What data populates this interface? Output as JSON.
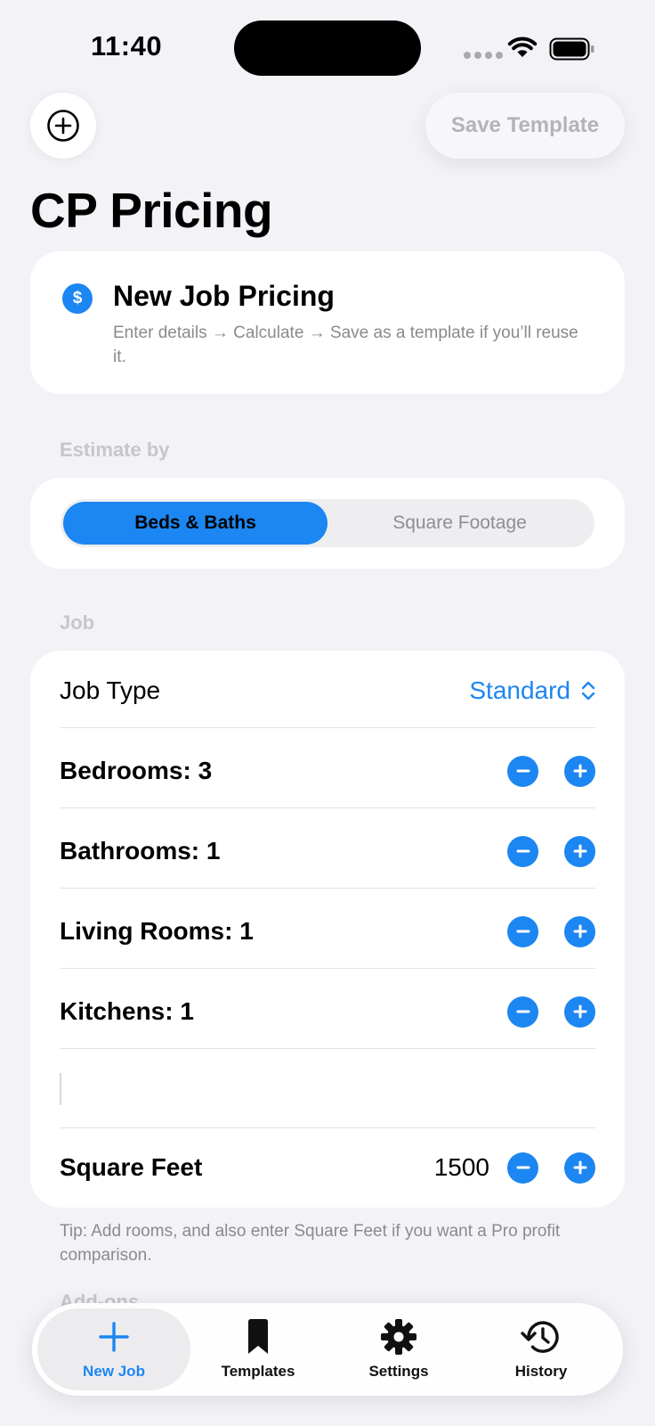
{
  "status": {
    "time": "11:40"
  },
  "top": {
    "add_label": "+",
    "save_template_label": "Save Template"
  },
  "page": {
    "title": "CP Pricing"
  },
  "intro": {
    "icon": "dollar-icon",
    "icon_glyph": "$",
    "title": "New Job Pricing",
    "description": "Enter details → Calculate → Save as a template if you’ll reuse it."
  },
  "estimate": {
    "label": "Estimate by",
    "options": [
      {
        "label": "Beds & Baths",
        "selected": true
      },
      {
        "label": "Square Footage",
        "selected": false
      }
    ]
  },
  "job": {
    "label": "Job",
    "job_type_label": "Job Type",
    "job_type_value": "Standard",
    "rows": [
      {
        "label": "Bedrooms: 3"
      },
      {
        "label": "Bathrooms: 1"
      },
      {
        "label": "Living Rooms: 1"
      },
      {
        "label": "Kitchens: 1"
      }
    ],
    "square_feet_label": "Square Feet",
    "square_feet_value": "1500"
  },
  "tip": "Tip: Add rooms, and also enter Square Feet if you want a Pro profit comparison.",
  "addons_label": "Add-ons",
  "tabs": [
    {
      "label": "New Job",
      "icon": "plus-icon",
      "active": true
    },
    {
      "label": "Templates",
      "icon": "bookmark-icon",
      "active": false
    },
    {
      "label": "Settings",
      "icon": "gear-icon",
      "active": false
    },
    {
      "label": "History",
      "icon": "history-icon",
      "active": false
    }
  ],
  "colors": {
    "accent": "#1c86f2",
    "background": "#f2f2f7",
    "card": "#ffffff"
  }
}
